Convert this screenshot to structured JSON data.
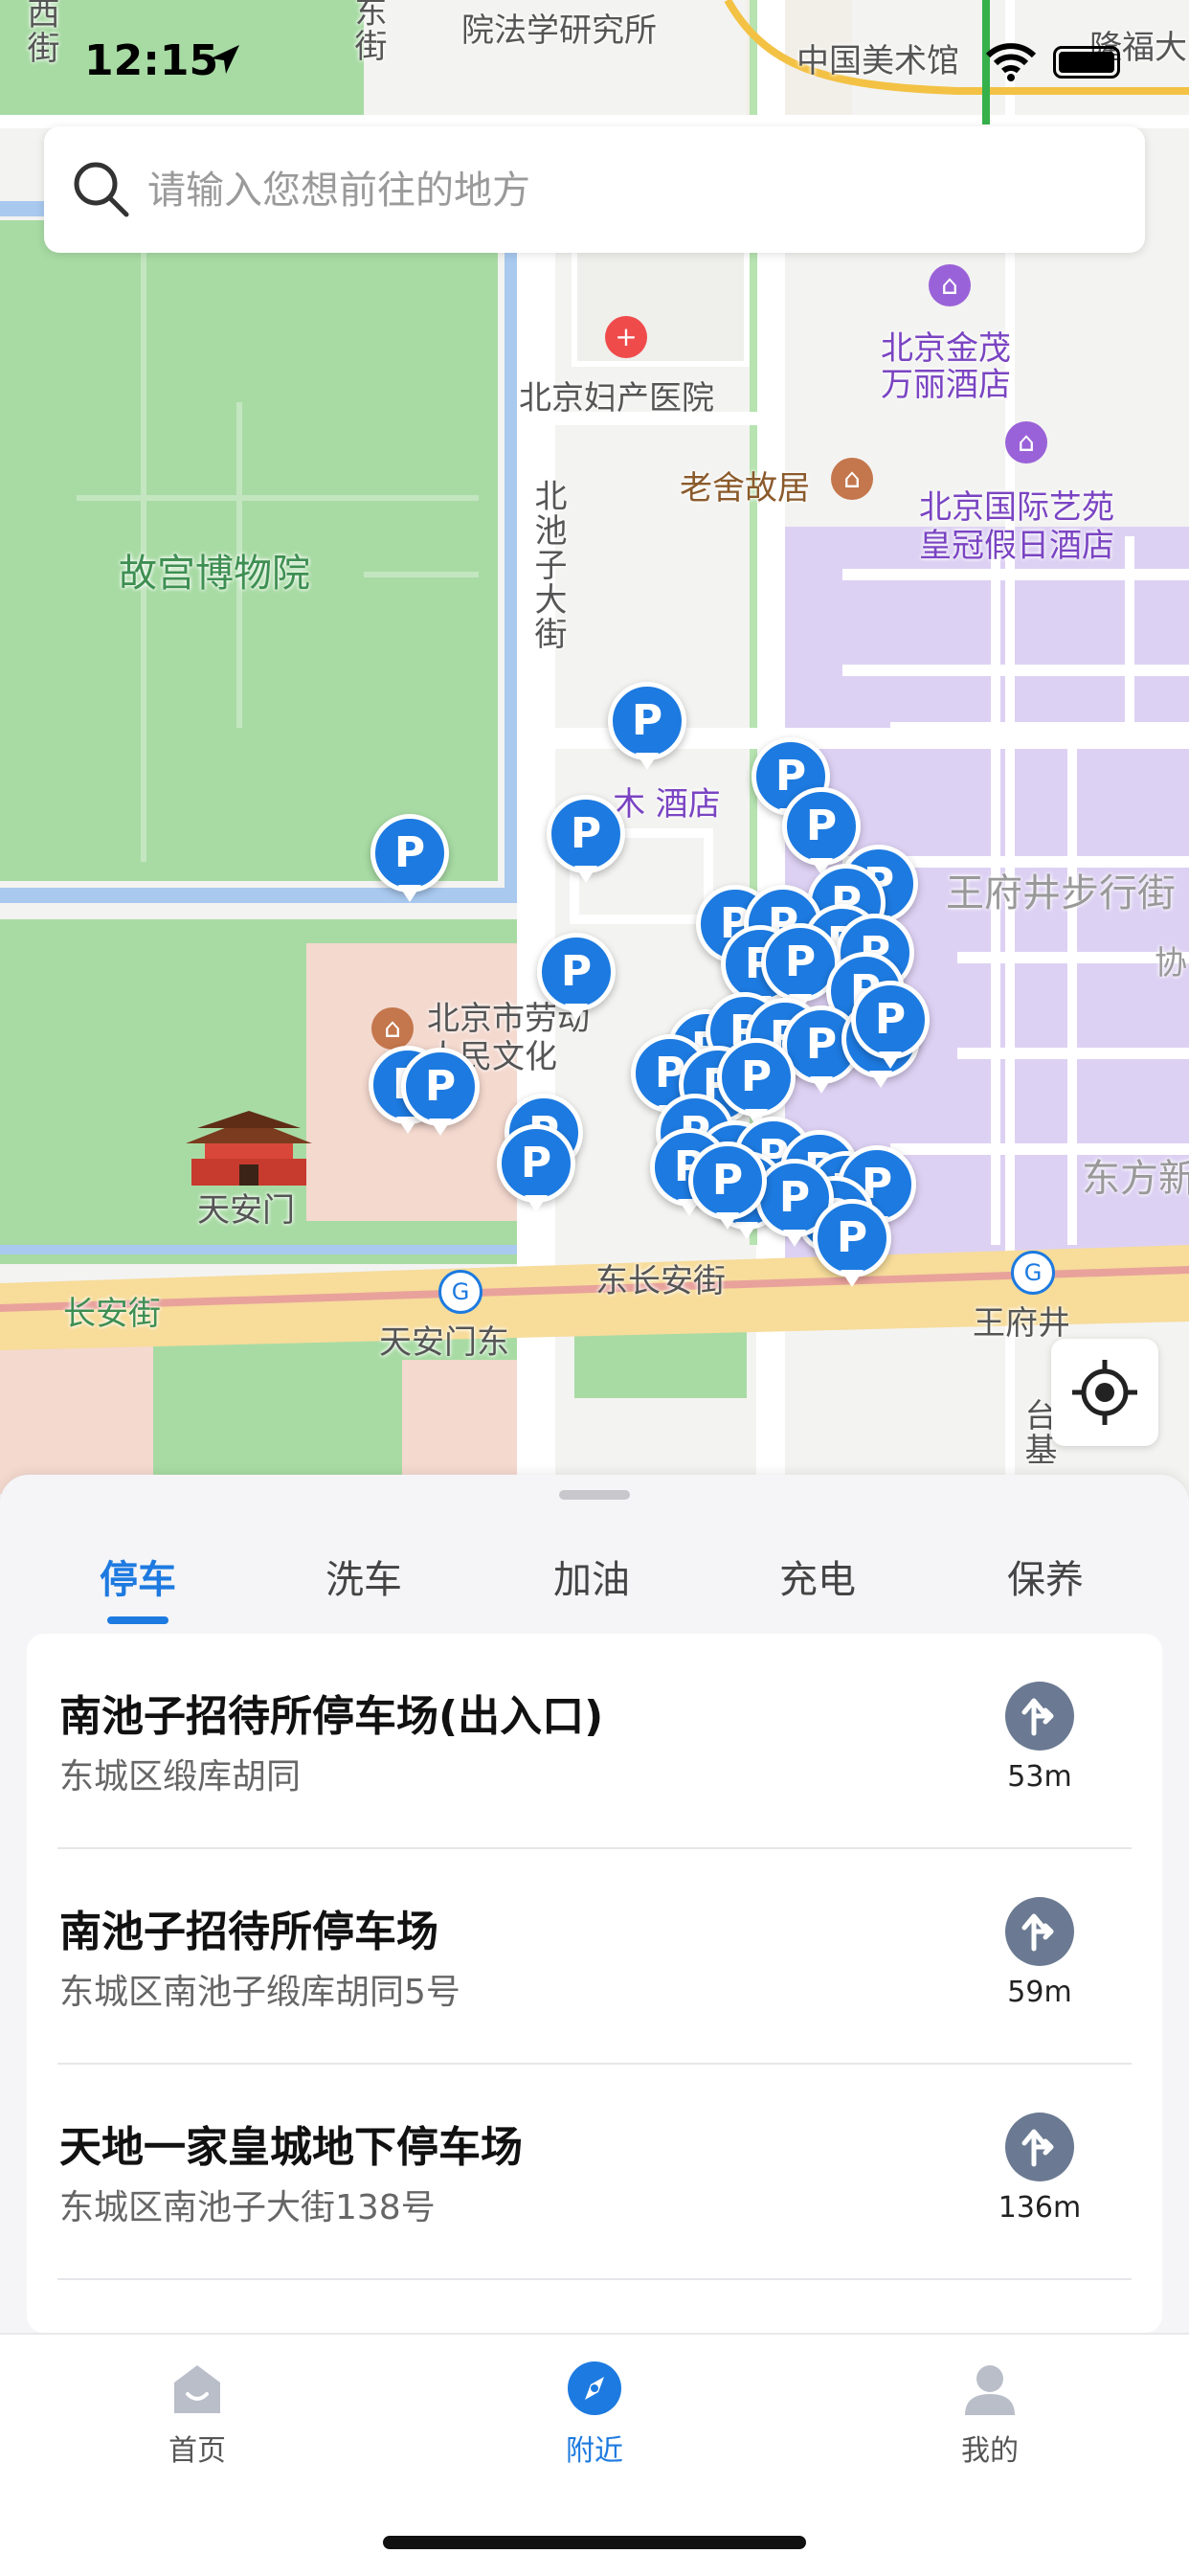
{
  "status": {
    "time": "12:15"
  },
  "search": {
    "placeholder": "请输入您想前往的地方"
  },
  "map": {
    "labels": {
      "top_left_vertical": "西街",
      "top_street_vertical": "东街",
      "institute": "院法学研究所",
      "art_museum": "中国美术馆",
      "longfu": "隆福大",
      "hospital": "北京妇产医院",
      "jinmao_1": "北京金茂",
      "jinmao_2": "万丽酒店",
      "laoshe": "老舍故居",
      "guoji_1": "北京国际艺苑",
      "guoji_2": "皇冠假日酒店",
      "palace_museum": "故宫博物院",
      "nanchizi_street": "北池子大街",
      "hotel_partial": "木   酒店",
      "wangfujing_walk": "王府井步行街",
      "xie": "协",
      "laodong_1": "北京市劳动",
      "laodong_2": "人民文化",
      "dongfang": "东方新",
      "tiananmen": "天安门",
      "changan_east": "东长安街",
      "changan": "长安街",
      "tiananmen_east": "天安门东",
      "wangfujing": "王府井",
      "taiji": "台基"
    },
    "parking_pin_label": "P"
  },
  "tabs": [
    {
      "label": "停车",
      "active": true
    },
    {
      "label": "洗车",
      "active": false
    },
    {
      "label": "加油",
      "active": false
    },
    {
      "label": "充电",
      "active": false
    },
    {
      "label": "保养",
      "active": false
    }
  ],
  "results": [
    {
      "name": "南池子招待所停车场(出入口)",
      "address": "东城区缎库胡同",
      "distance": "53m"
    },
    {
      "name": "南池子招待所停车场",
      "address": "东城区南池子缎库胡同5号",
      "distance": "59m"
    },
    {
      "name": "天地一家皇城地下停车场",
      "address": "东城区南池子大街138号",
      "distance": "136m"
    }
  ],
  "tabbar": [
    {
      "label": "首页",
      "icon": "home-icon",
      "active": false
    },
    {
      "label": "附近",
      "icon": "compass-icon",
      "active": true
    },
    {
      "label": "我的",
      "icon": "profile-icon",
      "active": false
    }
  ],
  "colors": {
    "accent": "#1d7ae0",
    "park_green": "#a8dba4",
    "commercial_purple": "#ddd1f3",
    "road_yellow": "#f7dc9a"
  }
}
